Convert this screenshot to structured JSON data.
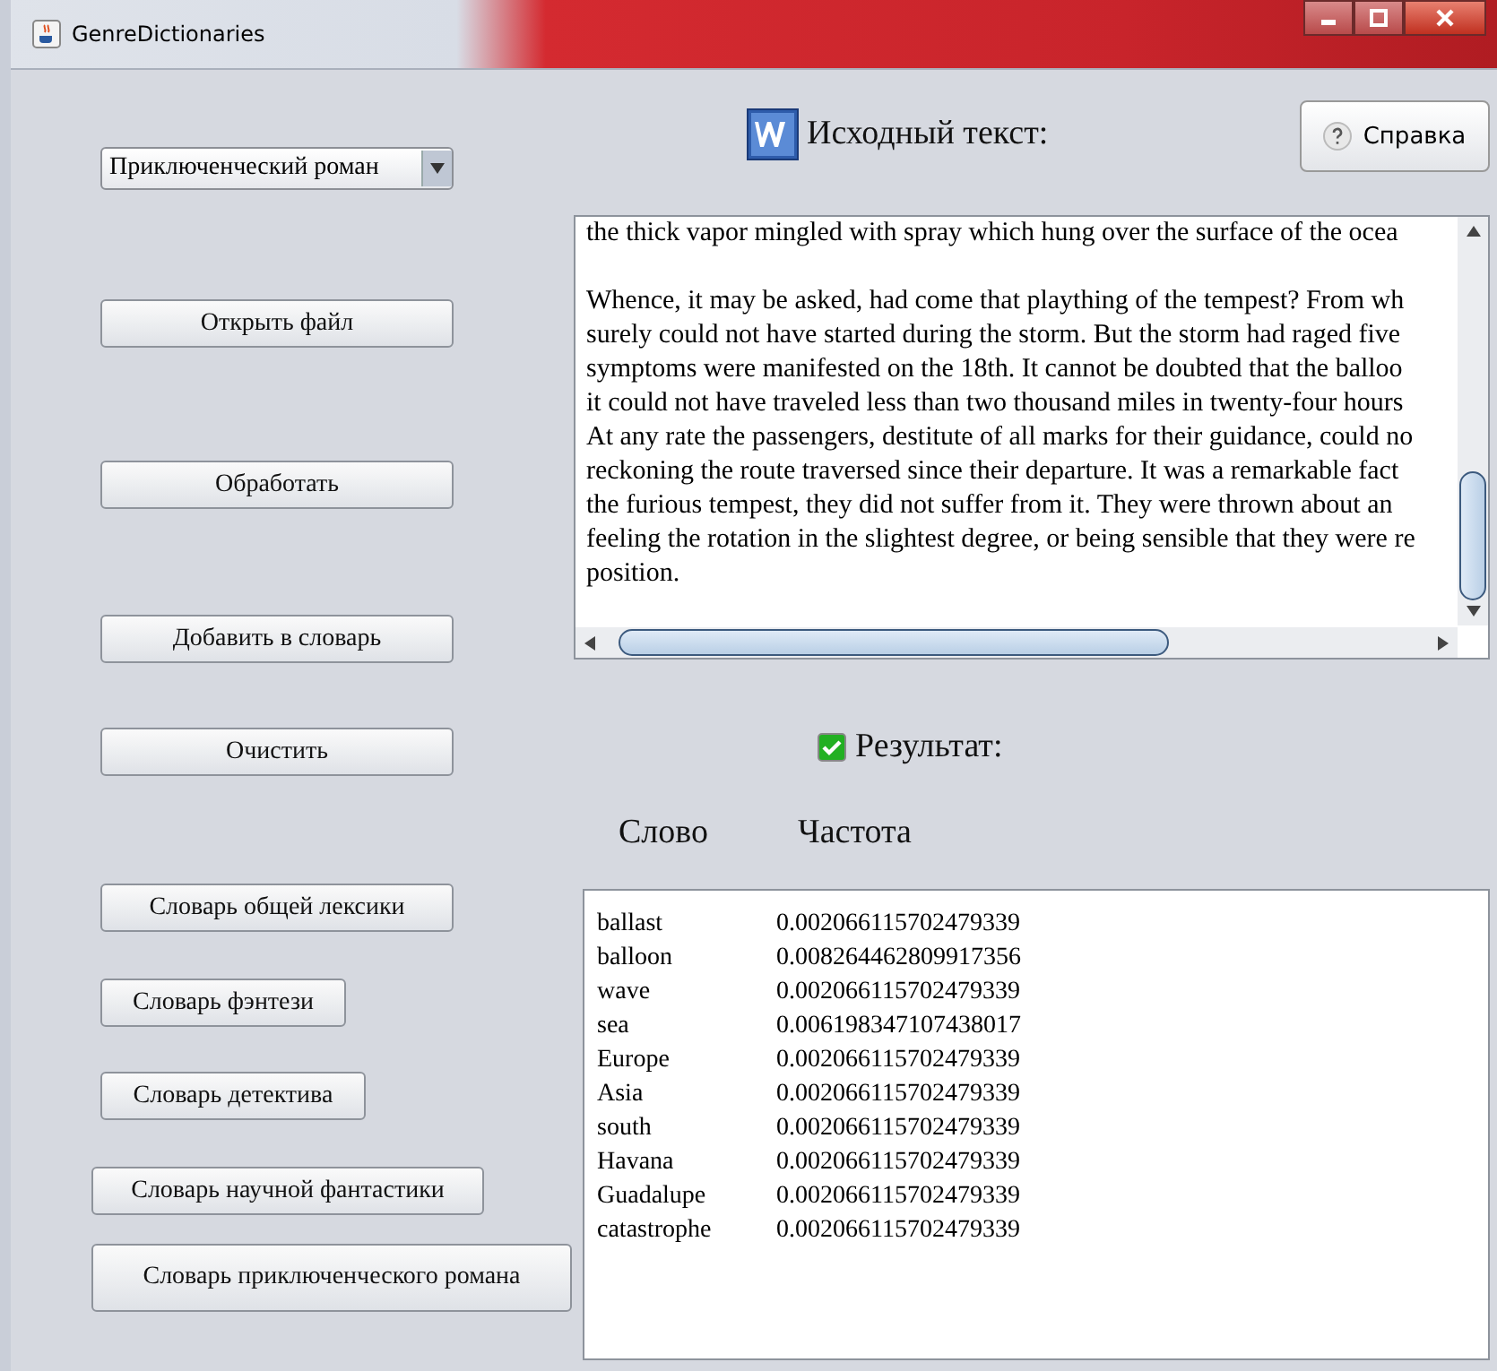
{
  "window": {
    "title": "GenreDictionaries"
  },
  "genre_select": {
    "value": "Приключенческий роман"
  },
  "left_buttons": [
    {
      "label": "Открыть файл"
    },
    {
      "label": "Обработать"
    },
    {
      "label": "Добавить в словарь"
    },
    {
      "label": "Очистить"
    },
    {
      "label": "Словарь общей лексики"
    },
    {
      "label": "Словарь фэнтези"
    },
    {
      "label": "Словарь детектива"
    },
    {
      "label": "Словарь научной фантастики"
    },
    {
      "label": "Словарь приключенческого романа"
    }
  ],
  "source_heading": "Исходный текст:",
  "help_button": {
    "label": "Справка"
  },
  "source_text": [
    [
      "the thick vapor mingled with spray which hung over the surface of the ocea"
    ],
    [
      "Whence, it may be asked, had come that plaything of the tempest? From wh",
      "surely could not have started during the storm. But the storm had raged five",
      "symptoms were manifested on the 18th. It cannot be doubted that the balloo",
      "it could not have traveled less than two thousand miles in twenty-four hours",
      "At any rate the passengers, destitute of all marks for their guidance, could no",
      "reckoning the route traversed since their departure. It was a remarkable fact",
      "the furious tempest, they did not suffer from it. They were thrown about an",
      "feeling the rotation in the slightest degree, or being sensible that they were re",
      "position."
    ]
  ],
  "result_heading": {
    "label": "Результат:",
    "checked": true
  },
  "table": {
    "columns": [
      "Слово",
      "Частота"
    ],
    "rows": [
      [
        "ballast",
        "0.002066115702479339"
      ],
      [
        "balloon",
        "0.008264462809917356"
      ],
      [
        "wave",
        "0.002066115702479339"
      ],
      [
        "sea",
        "0.006198347107438017"
      ],
      [
        "Europe",
        "0.002066115702479339"
      ],
      [
        "Asia",
        "0.002066115702479339"
      ],
      [
        "south",
        "0.002066115702479339"
      ],
      [
        "Havana",
        "0.002066115702479339"
      ],
      [
        "Guadalupe",
        "0.002066115702479339"
      ],
      [
        "catastrophe",
        "0.002066115702479339"
      ]
    ]
  }
}
